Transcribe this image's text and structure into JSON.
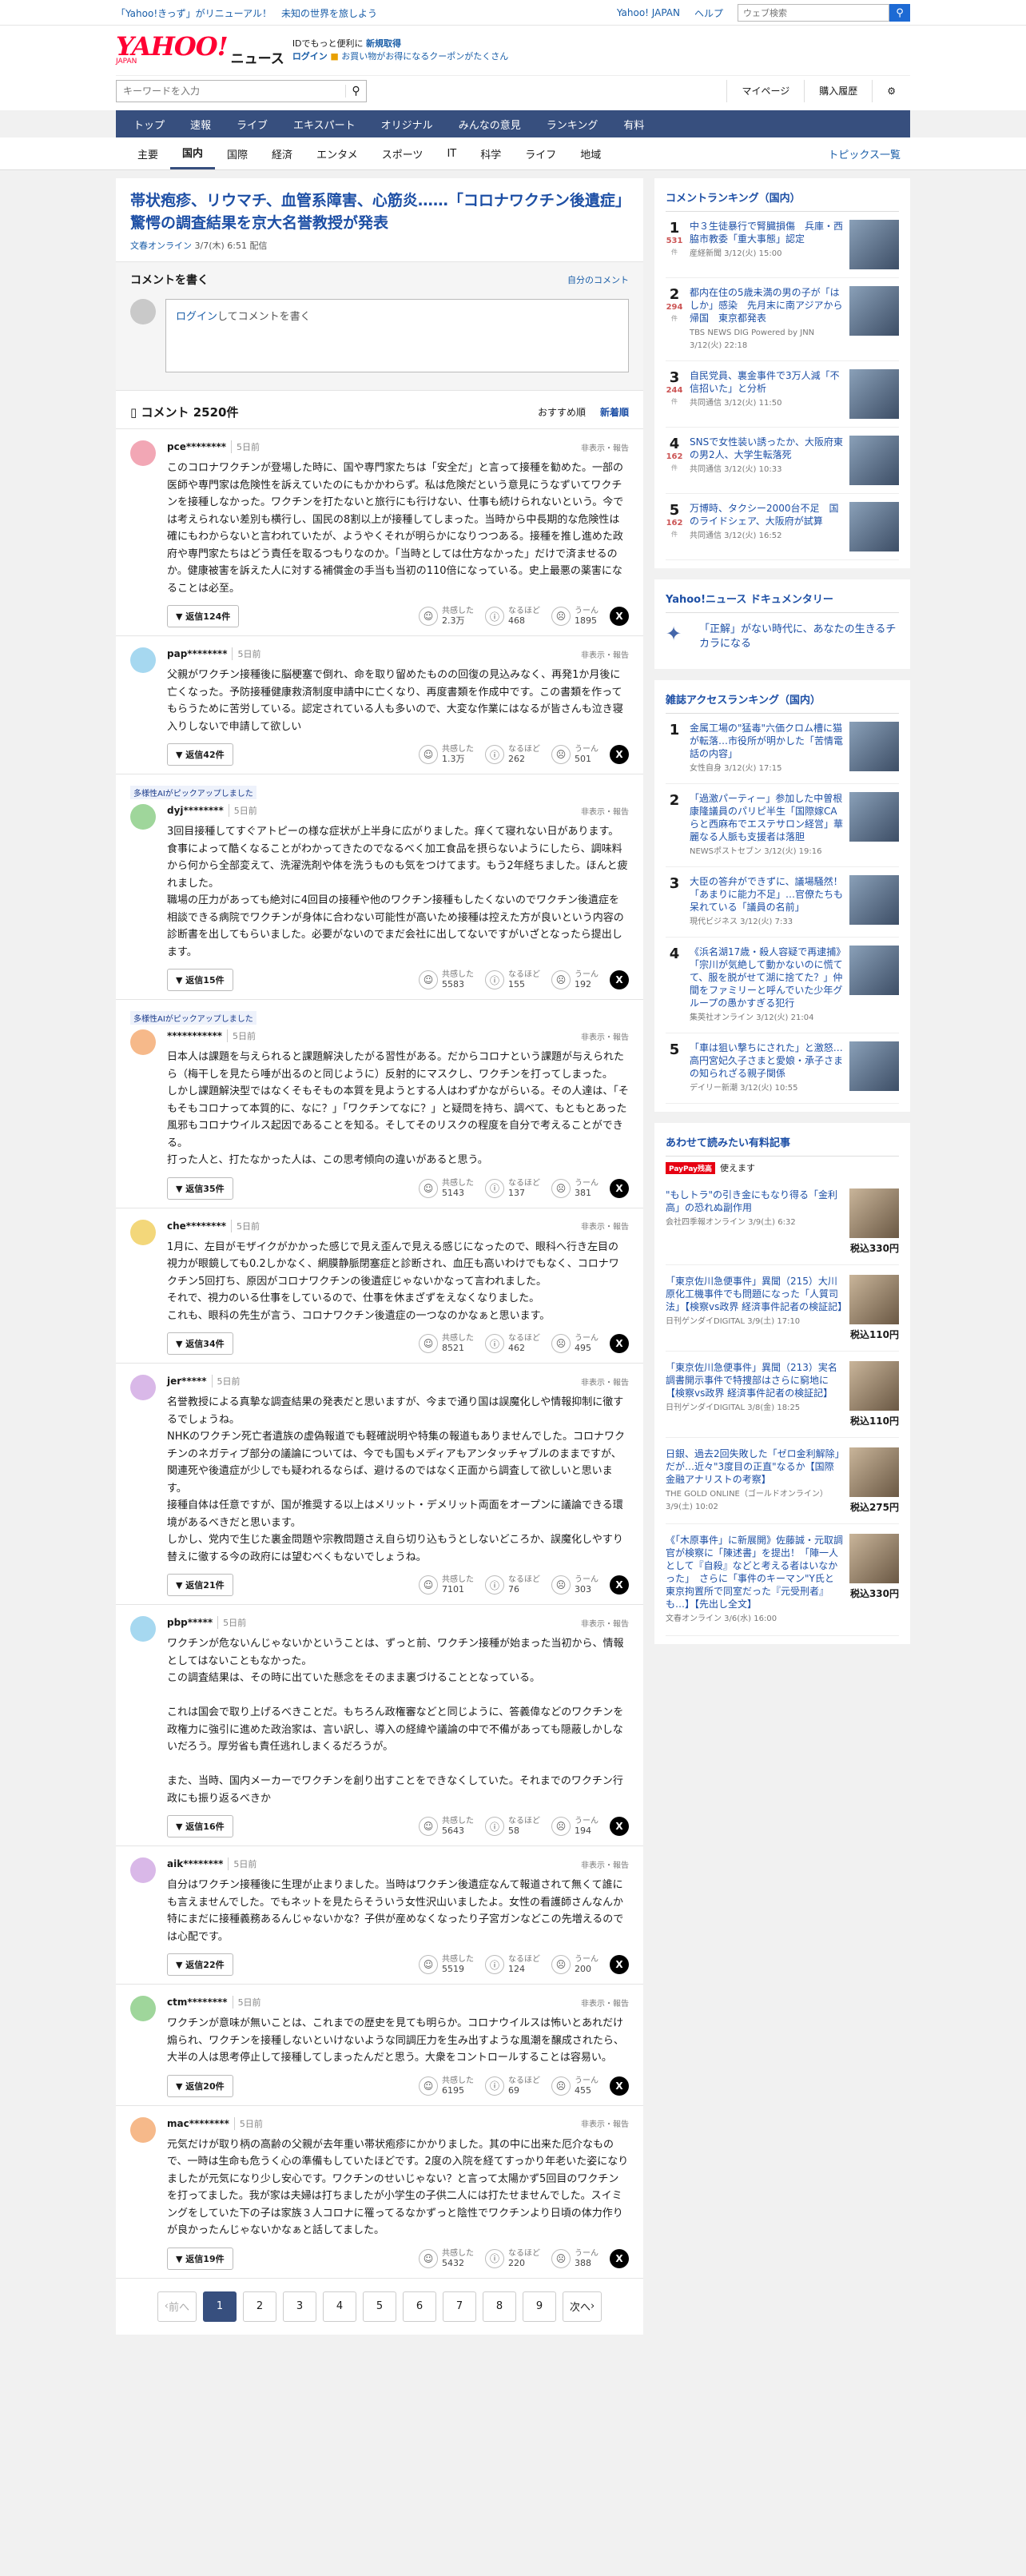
{
  "topbar": {
    "notice": "「Yahoo!きっず」がリニューアル！　未知の世界を旅しよう",
    "yj": "Yahoo! JAPAN",
    "help": "ヘルプ",
    "search_placeholder": "ウェブ検索"
  },
  "masthead": {
    "logo": "YAHOO!",
    "logo_sub": "JAPAN",
    "news": "ニュース",
    "id_text": "IDでもっと便利に",
    "register": "新規取得",
    "login": "ログイン",
    "coupon": "お買い物がお得になるクーポンがたくさん"
  },
  "toolbar": {
    "kw_placeholder": "キーワードを入力",
    "mypage": "マイページ",
    "purchase": "購入履歴"
  },
  "gnav": [
    "トップ",
    "速報",
    "ライブ",
    "エキスパート",
    "オリジナル",
    "みんなの意見",
    "ランキング",
    "有料"
  ],
  "subnav": [
    "主要",
    "国内",
    "国際",
    "経済",
    "エンタメ",
    "スポーツ",
    "IT",
    "科学",
    "ライフ",
    "地域"
  ],
  "topics": "トピックス一覧",
  "article": {
    "title": "帯状疱疹、リウマチ、血管系障害、心筋炎……「コロナワクチン後遺症」驚愕の調査結果を京大名誉教授が発表",
    "source": "文春オンライン",
    "date": "3/7(木) 6:51 配信"
  },
  "comment_write": {
    "title": "コメントを書く",
    "own": "自分のコメント",
    "login": "ログイン",
    "placeholder": "してコメントを書く"
  },
  "comments_header": {
    "count": "コメント 2520件",
    "sort_rec": "おすすめ順",
    "sort_new": "新着順"
  },
  "option_label": "非表示・報告",
  "ai_label": "多様性AIがピックアップしました",
  "react_labels": [
    "共感した",
    "なるほど",
    "うーん"
  ],
  "comments": [
    {
      "user": "pce********",
      "time": "5日前",
      "color": "#f2a7b5",
      "text": "このコロナワクチンが登場した時に、国や専門家たちは「安全だ」と言って接種を勧めた。一部の医師や専門家は危険性を訴えていたのにもかかわらず。私は危険だという意見にうなずいてワクチンを接種しなかった。ワクチンを打たないと旅行にも行けない、仕事も続けられないという。今では考えられない差別も横行し、国民の8割以上が接種してしまった。当時から中長期的な危険性は確にもわからないと言われていたが、ようやくそれが明らかになりつつある。接種を推し進めた政府や専門家たちはどう責任を取るつもりなのか。「当時としては仕方なかった」だけで済ませるのか。健康被害を訴えた人に対する補償金の手当も当初の110倍になっている。史上最悪の薬害になることは必至。",
      "reply": "返信124件",
      "r": [
        "2.3万",
        "468",
        "1895"
      ]
    },
    {
      "user": "pap********",
      "time": "5日前",
      "color": "#a6d8f0",
      "text": "父親がワクチン接種後に脳梗塞で倒れ、命を取り留めたものの回復の見込みなく、再発1か月後に亡くなった。予防接種健康救済制度申請中に亡くなり、再度書類を作成中です。この書類を作ってもらうために苦労している。認定されている人も多いので、大変な作業にはなるが皆さんも泣き寝入りしないで申請して欲しい",
      "reply": "返信42件",
      "r": [
        "1.3万",
        "262",
        "501"
      ]
    },
    {
      "ai": true,
      "user": "dyj********",
      "time": "5日前",
      "color": "#9fd69b",
      "text": "3回目接種してすぐアトピーの様な症状が上半身に広がりました。痒くて寝れない日があります。食事によって酷くなることがわかってきたのでなるべく加工食品を摂らないようにしたら、調味料から何から全部変えて、洗濯洗剤や体を洗うものも気をつけてます。もう2年経ちました。ほんと疲れました。\n職場の圧力があっても絶対に4回目の接種や他のワクチン接種もしたくないのでワクチン後遺症を相談できる病院でワクチンが身体に合わない可能性が高いため接種は控えた方が良いという内容の診断書を出してもらいました。必要がないのでまだ会社に出してないですがいざとなったら提出します。",
      "reply": "返信15件",
      "r": [
        "5583",
        "155",
        "192"
      ]
    },
    {
      "ai": true,
      "user": "***********",
      "time": "5日前",
      "color": "#f6b98a",
      "text": "日本人は課題を与えられると課題解決したがる習性がある。だからコロナという課題が与えられたら（梅干しを見たら唾が出るのと同じように）反射的にマスクし、ワクチンを打ってしまった。\nしかし課題解決型ではなくそもそもの本質を見ようとする人はわずかながらいる。その人達は、「そもそもコロナって本質的に、なに？」「ワクチンてなに？」と疑問を持ち、調べて、もともとあった風邪もコロナウイルス起因であることを知る。そしてそのリスクの程度を自分で考えることができる。\n打った人と、打たなかった人は、この思考傾向の違いがあると思う。",
      "reply": "返信35件",
      "r": [
        "5143",
        "137",
        "381"
      ]
    },
    {
      "user": "che********",
      "time": "5日前",
      "color": "#f3d77a",
      "text": "1月に、左目がモザイクがかかった感じで見え歪んで見える感じになったので、眼科へ行き左目の視力が眼鏡しても0.2しかなく、網膜静脈閉塞症と診断され、血圧も高いわけでもなく、コロナワクチン5回打ち、原因がコロナワクチンの後遺症じゃないかなって言われました。\nそれで、視力のいる仕事をしているので、仕事を休まざずをえなくなりました。\nこれも、眼科の先生が言う、コロナワクチン後遺症の一つなのかなぁと思います。",
      "reply": "返信34件",
      "r": [
        "8521",
        "462",
        "495"
      ]
    },
    {
      "user": "jer*****",
      "time": "5日前",
      "color": "#d9b8e8",
      "text": "名誉教授による真摯な調査結果の発表だと思いますが、今まで通り国は誤魔化しや情報抑制に徹するでしょうね。\nNHKのワクチン死亡者遺族の虚偽報道でも軽確説明や特集の報道もありませんでした。コロナワクチンのネガティブ部分の議論については、今でも国もメディアもアンタッチャブルのままですが、関連死や後遺症が少しでも疑われるならば、避けるのではなく正面から調査して欲しいと思います。\n接種自体は任意ですが、国が推奨する以上はメリット・デメリット両面をオープンに議論できる環境があるべきだと思います。\nしかし、党内で生じた裏金問題や宗教問題さえ自ら切り込もうとしないどころか、誤魔化しやすり替えに徹する今の政府には望むべくもないでしょうね。",
      "reply": "返信21件",
      "r": [
        "7101",
        "76",
        "303"
      ]
    },
    {
      "user": "pbp*****",
      "time": "5日前",
      "color": "#a6d8f0",
      "text": "ワクチンが危ないんじゃないかということは、ずっと前、ワクチン接種が始まった当初から、情報としてはないこともなかった。\nこの調査結果は、その時に出ていた懸念をそのまま裏づけることとなっている。\n\nこれは国会で取り上げるべきことだ。もちろん政権審などと同じように、答義偉などのワクチンを政権力に強引に進めた政治家は、言い訳し、導入の経緯や議論の中で不備があっても隠蔽しかしないだろう。厚労省も責任逃れしまくるだろうが。\n\nまた、当時、国内メーカーでワクチンを創り出すことをできなくしていた。それまでのワクチン行政にも振り返るべきか",
      "reply": "返信16件",
      "r": [
        "5643",
        "58",
        "194"
      ]
    },
    {
      "user": "aik********",
      "time": "5日前",
      "color": "#d9b8e8",
      "text": "自分はワクチン接種後に生理が止まりました。当時はワクチン後遺症なんて報道されて無くて誰にも言えませんでした。でもネットを見たらそういう女性沢山いましたよ。女性の看護師さんなんか特にまだに接種義務あるんじゃないかな？子供が産めなくなったり子宮ガンなどこの先増えるのでは心配です。",
      "reply": "返信22件",
      "r": [
        "5519",
        "124",
        "200"
      ]
    },
    {
      "user": "ctm********",
      "time": "5日前",
      "color": "#9fd69b",
      "text": "ワクチンが意味が無いことは、これまでの歴史を見ても明らか。コロナウイルスは怖いとあれだけ煽られ、ワクチンを接種しないといけないような同調圧力を生み出すような風潮を醸成されたら、大半の人は思考停止して接種してしまったんだと思う。大衆をコントロールすることは容易い。",
      "reply": "返信20件",
      "r": [
        "6195",
        "69",
        "455"
      ]
    },
    {
      "user": "mac********",
      "time": "5日前",
      "color": "#f6b98a",
      "text": "元気だけが取り柄の高齢の父親が去年重い帯状疱疹にかかりました。其の中に出来た厄介なもので、一時は生命も危うく心の準備もしていたほどです。2度の入院を経てすっかり年老いた姿になりましたが元気になり少し安心です。ワクチンのせいじゃない？と言って太陽かず5回目のワクチンを打ってました。我が家は夫婦は打ちましたが小学生の子供二人には打たせませんでした。スイミングをしていた下の子は家族３人コロナに罹ってるなかずっと陰性でワクチンより日頃の体力作りが良かったんじゃないかなぁと話してました。",
      "reply": "返信19件",
      "r": [
        "5432",
        "220",
        "388"
      ]
    }
  ],
  "pager": {
    "prev": "前へ",
    "next": "次へ",
    "pages": [
      "1",
      "2",
      "3",
      "4",
      "5",
      "6",
      "7",
      "8",
      "9"
    ]
  },
  "side": {
    "comment_rank_title": "コメントランキング（国内）",
    "comment_rank": [
      {
        "n": "1",
        "cnt": "531",
        "title": "中３生徒暴行で腎臓損傷　兵庫・西脇市教委「重大事態」認定",
        "src": "産経新聞 3/12(火) 15:00"
      },
      {
        "n": "2",
        "cnt": "294",
        "title": "都内在住の5歳未満の男の子が「はしか」感染　先月末に南アジアから帰国　東京都発表",
        "src": "TBS NEWS DIG Powered by JNN 3/12(火) 22:18"
      },
      {
        "n": "3",
        "cnt": "244",
        "title": "自民党員、裏金事件で3万人減「不信招いた」と分析",
        "src": "共同通信 3/12(火) 11:50"
      },
      {
        "n": "4",
        "cnt": "162",
        "title": "SNSで女性装い誘ったか、大阪府東の男2人、大学生転落死",
        "src": "共同通信 3/12(火) 10:33"
      },
      {
        "n": "5",
        "cnt": "162",
        "title": "万博時、タクシー2000台不足　国のライドシェア、大阪府が試算",
        "src": "共同通信 3/12(火) 16:52"
      }
    ],
    "cnt_unit": "件",
    "doc_title": "Yahoo!ニュース ドキュメンタリー",
    "doc_item": "「正解」がない時代に、あなたの生きるチカラになる",
    "mag_title": "雑誌アクセスランキング（国内）",
    "mag_rank": [
      {
        "n": "1",
        "title": "金属工場の\"猛毒\"六価クロム槽に猫が転落…市役所が明かした「苦情電話の内容」",
        "src": "女性自身 3/12(火) 17:15"
      },
      {
        "n": "2",
        "title": "「過激パーティー」参加した中曽根康隆議員のパリピ半生「国際嫁CAらと西麻布でエステサロン経営」華麗なる人脈も支援者は落胆",
        "src": "NEWSポストセブン 3/12(火) 19:16"
      },
      {
        "n": "3",
        "title": "大臣の答弁ができずに、議場騒然！「あまりに能力不足」…官僚たちも呆れている「議員の名前」",
        "src": "現代ビジネス 3/12(火) 7:33"
      },
      {
        "n": "4",
        "title": "《浜名湖17歳・殺人容疑で再逮捕》「宗川が気絶して動かないのに慌てて、服を脱がせて湖に捨てた？」仲間をファミリーと呼んでいた少年グループの愚かすぎる犯行",
        "src": "集英社オンライン 3/12(火) 21:04"
      },
      {
        "n": "5",
        "title": "「車は狙い撃ちにされた」と激怒…高円宮妃久子さまと愛娘・承子さまの知られざる親子関係",
        "src": "デイリー新潮 3/12(火) 10:55"
      }
    ],
    "pp_title": "あわせて読みたい有料記事",
    "pp_badge": "PayPay残高",
    "pp_use": "使えます",
    "pp_items": [
      {
        "title": "\"もしトラ\"の引き金にもなり得る「金利高」の恐れぬ副作用",
        "src": "会社四季報オンライン 3/9(土) 6:32",
        "price": "税込330円"
      },
      {
        "title": "「東京佐川急便事件」異聞（215）大川原化工機事件でも問題になった「人質司法」【検察vs政界 経済事件記者の検証記】",
        "src": "日刊ゲンダイDIGITAL 3/9(土) 17:10",
        "price": "税込110円"
      },
      {
        "title": "「東京佐川急便事件」異聞（213）実名調書開示事件で特捜部はさらに窮地に【検察vs政界 経済事件記者の検証記】",
        "src": "日刊ゲンダイDIGITAL 3/8(金) 18:25",
        "price": "税込110円"
      },
      {
        "title": "日銀、過去2回失敗した「ゼロ金利解除」だが…近々\"3度目の正直\"なるか【国際金融アナリストの考察】",
        "src": "THE GOLD ONLINE（ゴールドオンライン） 3/9(土) 10:02",
        "price": "税込275円"
      },
      {
        "title": "《「木原事件」に新展開》佐藤誠・元取調官が検察に「陳述書」を提出！「陣一人として『自殺』などと考える者はいなかった」　さらに「事件のキーマン\"Y氏と東京拘置所で同室だった『元受刑者』も…】【先出し全文】",
        "src": "文春オンライン 3/6(水) 16:00",
        "price": "税込330円"
      }
    ]
  }
}
